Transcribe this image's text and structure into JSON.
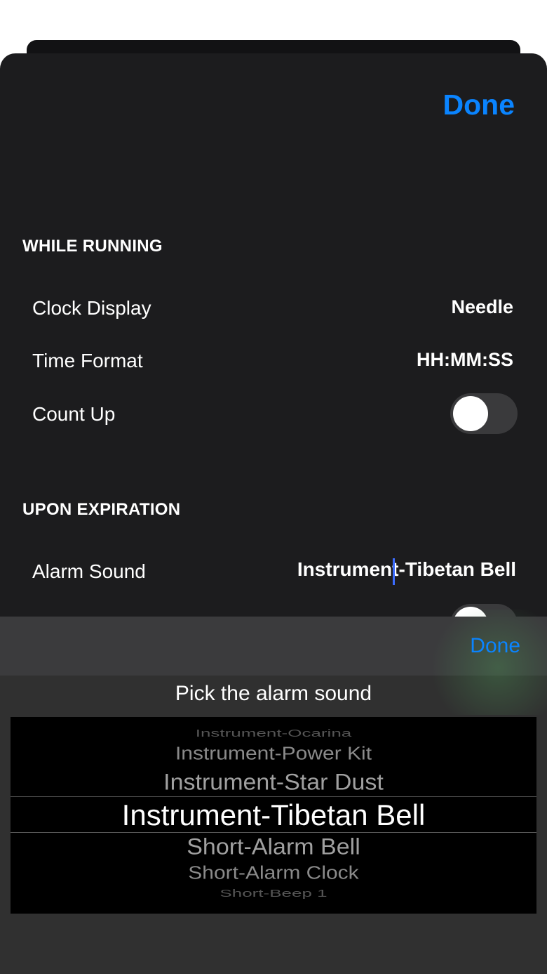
{
  "header": {
    "done_label": "Done"
  },
  "while_running": {
    "title": "WHILE RUNNING",
    "rows": [
      {
        "label": "Clock Display",
        "value": "Needle"
      },
      {
        "label": "Time Format",
        "value": "HH:MM:SS"
      },
      {
        "label": "Count Up"
      }
    ]
  },
  "upon_expiration": {
    "title": "UPON EXPIRATION",
    "alarm_label": "Alarm Sound",
    "alarm_value": "Instrument-Tibetan Bell"
  },
  "picker": {
    "done_label": "Done",
    "title": "Pick the alarm sound",
    "options": [
      "Instrument-Ocarina",
      "Instrument-Power Kit",
      "Instrument-Star Dust",
      "Instrument-Tibetan Bell",
      "Short-Alarm Bell",
      "Short-Alarm Clock",
      "Short-Beep 1"
    ],
    "selected": "Instrument-Tibetan Bell"
  },
  "colors": {
    "accent": "#0a84ff",
    "sheet": "#1c1c1e",
    "caret": "#3b6cff"
  },
  "toggles": {
    "count_up": false
  }
}
